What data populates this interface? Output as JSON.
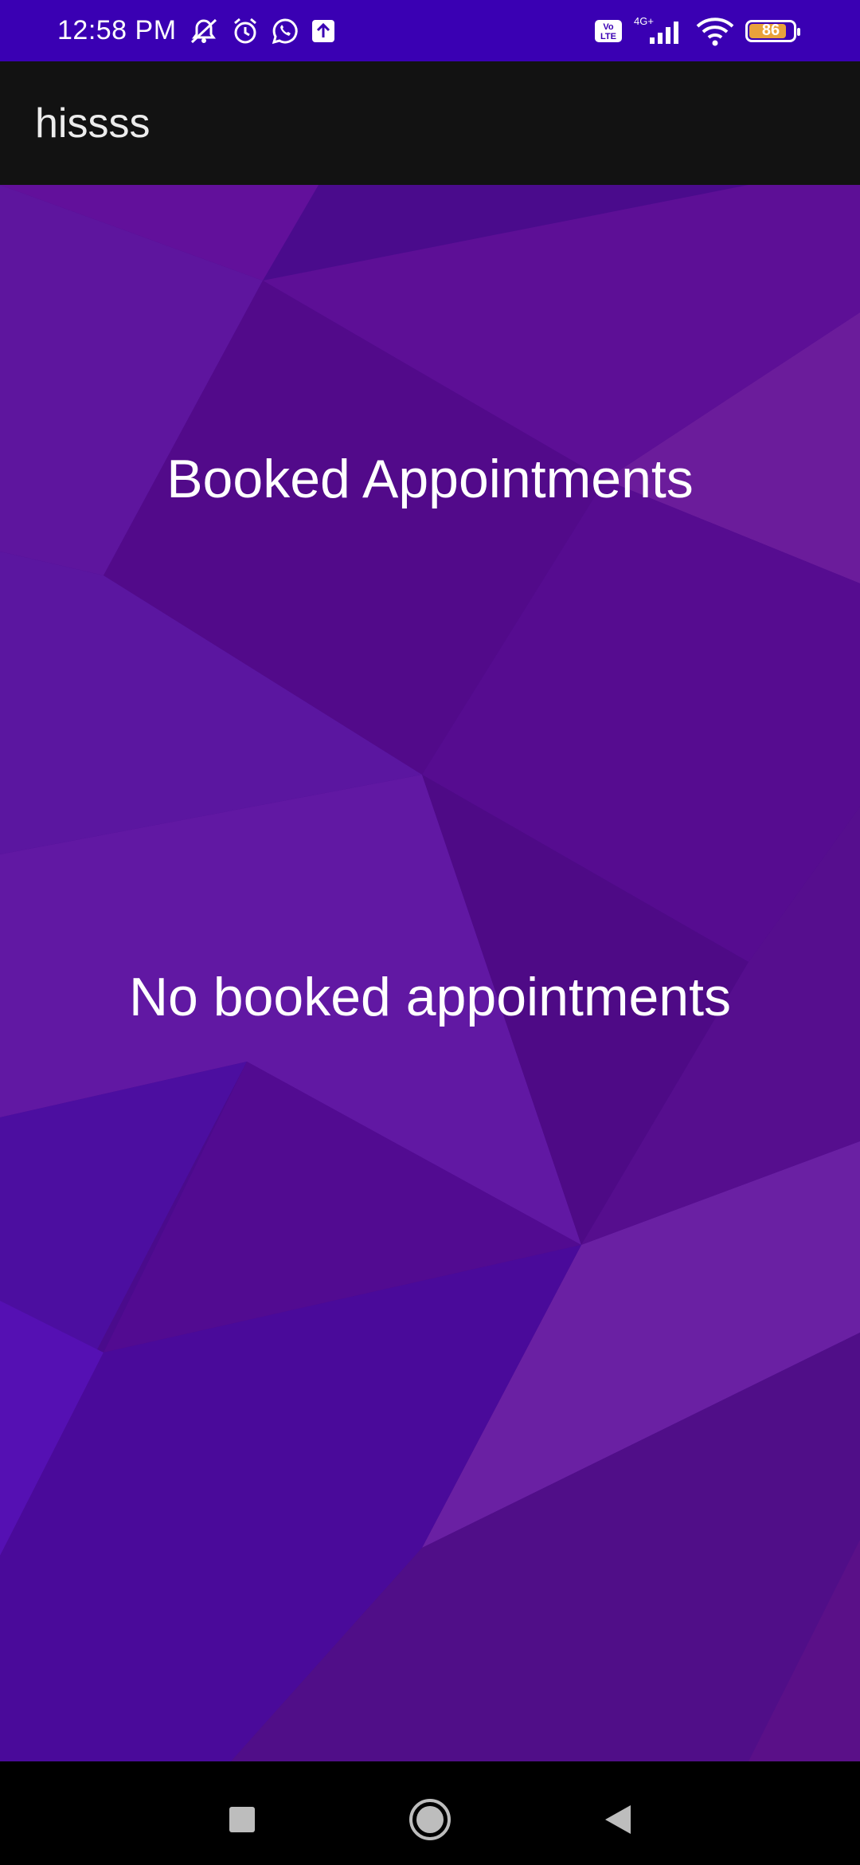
{
  "status_bar": {
    "time": "12:58 PM",
    "icons_left": [
      "mute-notifications-icon",
      "alarm-icon",
      "whatsapp-icon",
      "upload-icon"
    ],
    "icons_right": [
      "volte-icon",
      "signal-4g-icon",
      "wifi-icon",
      "battery-icon"
    ],
    "network": "4G+",
    "volte_label": "Vo LTE",
    "battery_level": "86"
  },
  "app_bar": {
    "title": "hissss"
  },
  "main": {
    "heading": "Booked Appointments",
    "empty_message": "No booked appointments"
  },
  "nav_bar": {
    "buttons": [
      "recents-icon",
      "home-icon",
      "back-icon"
    ]
  },
  "colors": {
    "status_bar": "#3a00b3",
    "app_bar": "#121212",
    "background_purple": "#4b0c8f",
    "text": "#ffffff"
  }
}
